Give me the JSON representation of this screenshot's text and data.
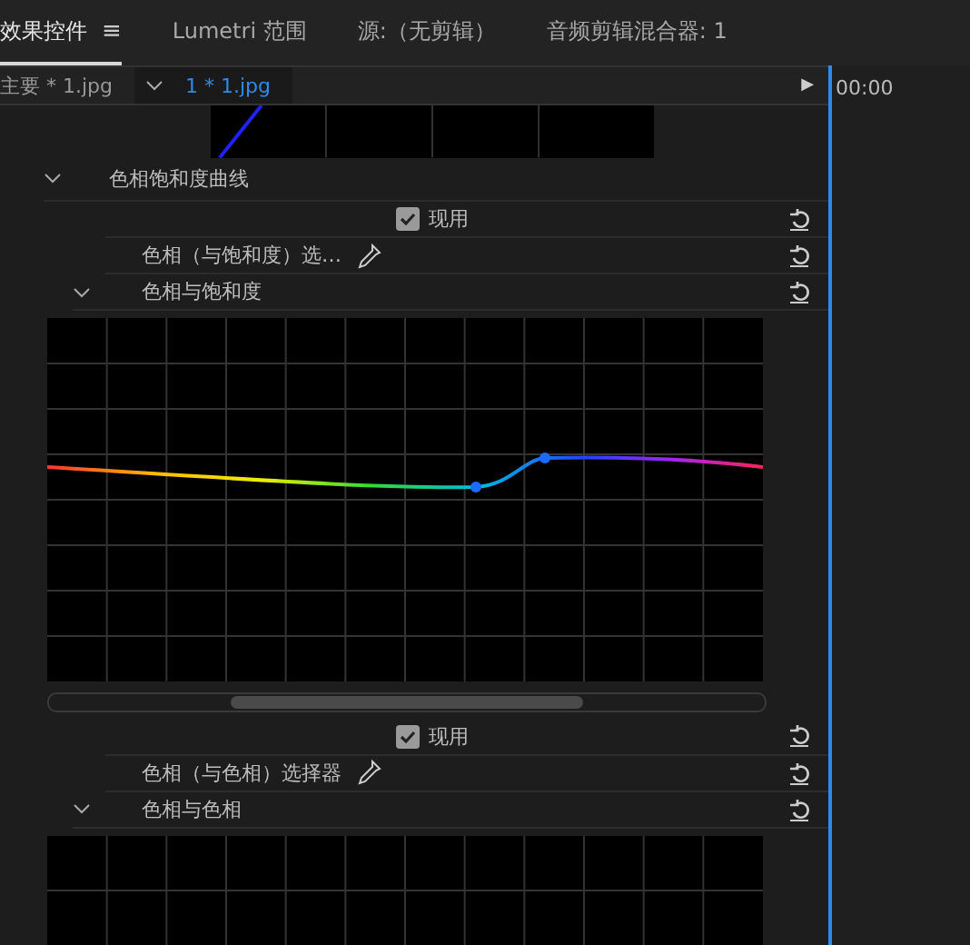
{
  "panel_tabs": [
    {
      "label": "效果控件",
      "selected": true,
      "menu": "≡"
    },
    {
      "label": "Lumetri 范围",
      "selected": false
    },
    {
      "label": "源:（无剪辑）",
      "selected": false
    },
    {
      "label": "音频剪辑混合器: 1",
      "selected": false
    }
  ],
  "clip_tabs": [
    {
      "label": "主要 * 1.jpg",
      "selected": false
    },
    {
      "label": "1 * 1.jpg",
      "selected": true
    }
  ],
  "play_button": "▶",
  "timecode": "00:00",
  "sections": [
    {
      "kind": "heading",
      "label": "色相饱和度曲线",
      "expanded": true
    },
    {
      "kind": "checkbox",
      "label": "现用",
      "checked": true
    },
    {
      "kind": "picker",
      "label": "色相（与饱和度）选…"
    },
    {
      "kind": "curve",
      "label": "色相与饱和度",
      "expanded": true,
      "curve_shown": true
    },
    {
      "kind": "checkbox",
      "label": "现用",
      "checked": true
    },
    {
      "kind": "picker",
      "label": "色相（与色相）选择器"
    },
    {
      "kind": "curve",
      "label": "色相与色相",
      "expanded": true,
      "curve_shown": false
    }
  ]
}
